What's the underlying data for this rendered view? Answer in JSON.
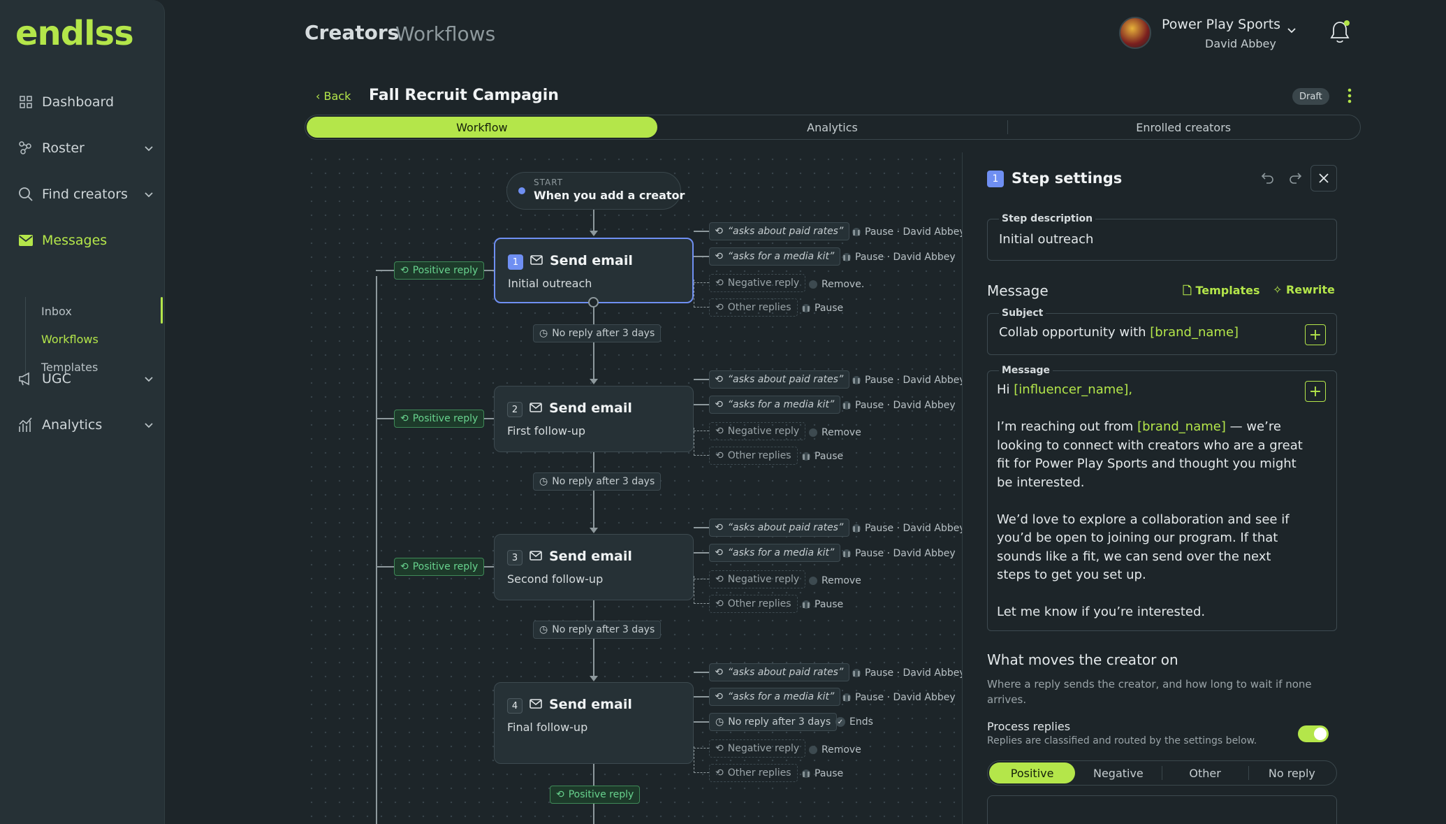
{
  "sidebar": {
    "logo": "endlss",
    "items": [
      {
        "label": "Dashboard",
        "icon": "grid-icon"
      },
      {
        "label": "Roster",
        "icon": "people-icon"
      },
      {
        "label": "Find creators",
        "icon": "search-icon"
      },
      {
        "label": "Messages",
        "icon": "mail-icon"
      },
      {
        "label": "UGC",
        "icon": "megaphone-icon"
      },
      {
        "label": "Analytics",
        "icon": "chart-icon"
      }
    ],
    "messages_sub": [
      "Inbox",
      "Workflows",
      "Templates"
    ]
  },
  "header": {
    "title": "Creators",
    "subtitle": "Workflows",
    "brand": "Power Play Sports",
    "user": "David Abbey"
  },
  "campaign": {
    "back": "Back",
    "title": "Fall Recruit Campagin",
    "status": "Draft"
  },
  "tabs": [
    "Workflow",
    "Analytics",
    "Enrolled creators"
  ],
  "workflow": {
    "start_label": "START",
    "start_text": "When you add a creator",
    "positive": "Positive reply",
    "delay": "No reply after 3 days",
    "reply_paid": "“asks about paid rates”",
    "reply_kit": "“asks for a media kit”",
    "negative": "Negative reply",
    "other": "Other replies",
    "action_pause_user": "Pause · David Abbey",
    "action_remove": "Remove",
    "action_remove_dot": "Remove.",
    "action_pause": "Pause",
    "action_ends": "Ends",
    "steps": [
      {
        "num": "1",
        "title": "Send email",
        "desc": "Initial outreach"
      },
      {
        "num": "2",
        "title": "Send email",
        "desc": "First follow-up"
      },
      {
        "num": "3",
        "title": "Send email",
        "desc": "Second follow-up"
      },
      {
        "num": "4",
        "title": "Send email",
        "desc": "Final follow-up"
      }
    ]
  },
  "settings": {
    "num": "1",
    "title": "Step settings",
    "desc_label": "Step description",
    "desc_value": "Initial outreach",
    "message_heading": "Message",
    "templates": "Templates",
    "rewrite": "Rewrite",
    "subject_label": "Subject",
    "subject_prefix": "Collab opportunity with ",
    "subject_token": "[brand_name]",
    "message_label": "Message",
    "greeting": "Hi ",
    "greeting_token": "[influencer_name],",
    "p1_a": "I’m reaching out from ",
    "p1_token": "[brand_name]",
    "p1_b": " — we’re looking to connect with creators who are a great fit for Power Play Sports and thought you might be interested.",
    "p2": "We’d love to explore a collaboration and see if you’d be open to joining our program. If that sounds like a fit, we can send over the next steps to get you set up.",
    "p3": "Let me know if you’re interested.",
    "moves_title": "What moves the creator on",
    "moves_desc": "Where a reply sends the creator, and how long to wait if none arrives.",
    "process_title": "Process replies",
    "process_desc": "Replies are classified and routed by the settings below.",
    "process_on": true,
    "segments": [
      "Positive",
      "Negative",
      "Other",
      "No reply"
    ]
  },
  "colors": {
    "accent": "#b4e64a",
    "selected": "#6f8ff2",
    "positive": "#68d38e"
  }
}
